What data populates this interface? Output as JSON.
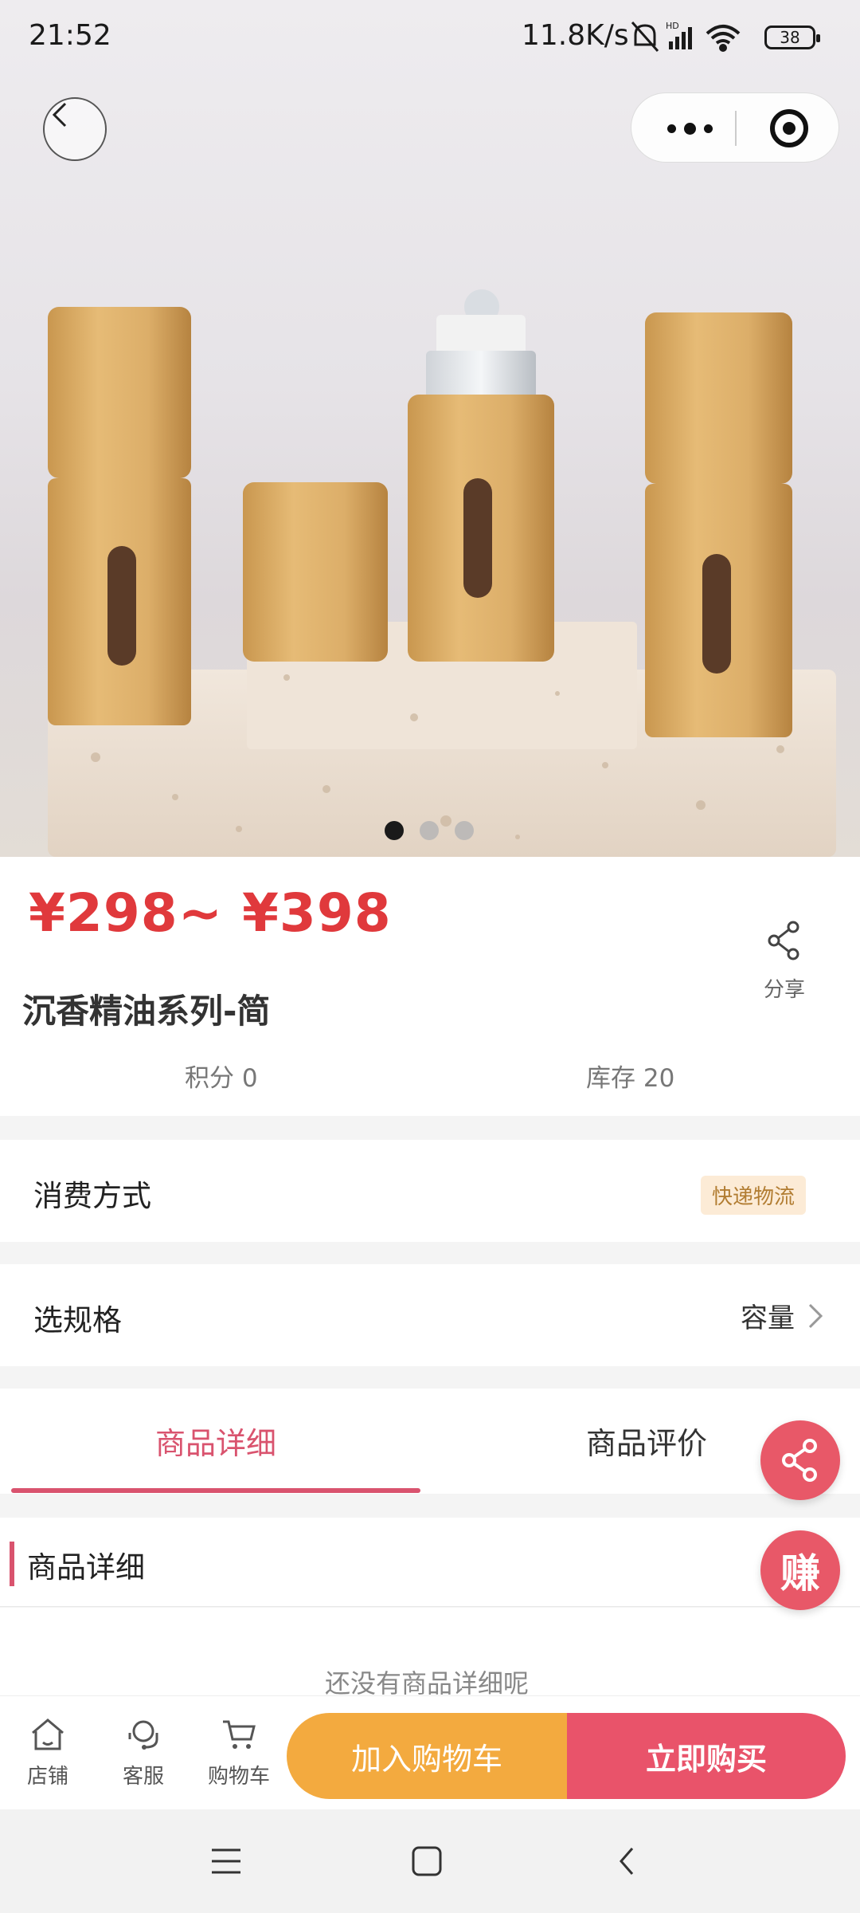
{
  "status_bar": {
    "time": "21:52",
    "network_speed": "11.8K/s",
    "icons": [
      "bell-muted-icon",
      "hd-signal-icon",
      "wifi-icon"
    ],
    "battery": "38"
  },
  "header": {
    "back_icon": "chevron-left-icon",
    "menu_icon": "more-dots-icon",
    "close_icon": "target-circle-icon"
  },
  "carousel": {
    "total": 3,
    "active": 0
  },
  "product": {
    "price": "¥298~ ¥398",
    "title": "沉香精油系列-简",
    "points": "积分 0",
    "stock": "库存 20",
    "share_label": "分享"
  },
  "consumption": {
    "label": "消费方式",
    "tag": "快递物流"
  },
  "spec": {
    "label": "选规格",
    "value": "容量"
  },
  "tabs": [
    {
      "label": "商品详细",
      "active": true
    },
    {
      "label": "商品评价",
      "active": false
    }
  ],
  "detail": {
    "section_title": "商品详细",
    "empty_text": "还没有商品详细呢"
  },
  "floating": {
    "earn_label": "赚"
  },
  "bottom_bar": {
    "nav": [
      {
        "label": "店铺",
        "icon": "store-icon"
      },
      {
        "label": "客服",
        "icon": "customer-service-icon"
      },
      {
        "label": "购物车",
        "icon": "cart-icon"
      }
    ],
    "add_to_cart": "加入购物车",
    "buy_now": "立即购买"
  },
  "colors": {
    "price": "#e0393c",
    "accent": "#d9536e",
    "cart_button": "#f3aa3f",
    "buy_button": "#e9536a"
  }
}
